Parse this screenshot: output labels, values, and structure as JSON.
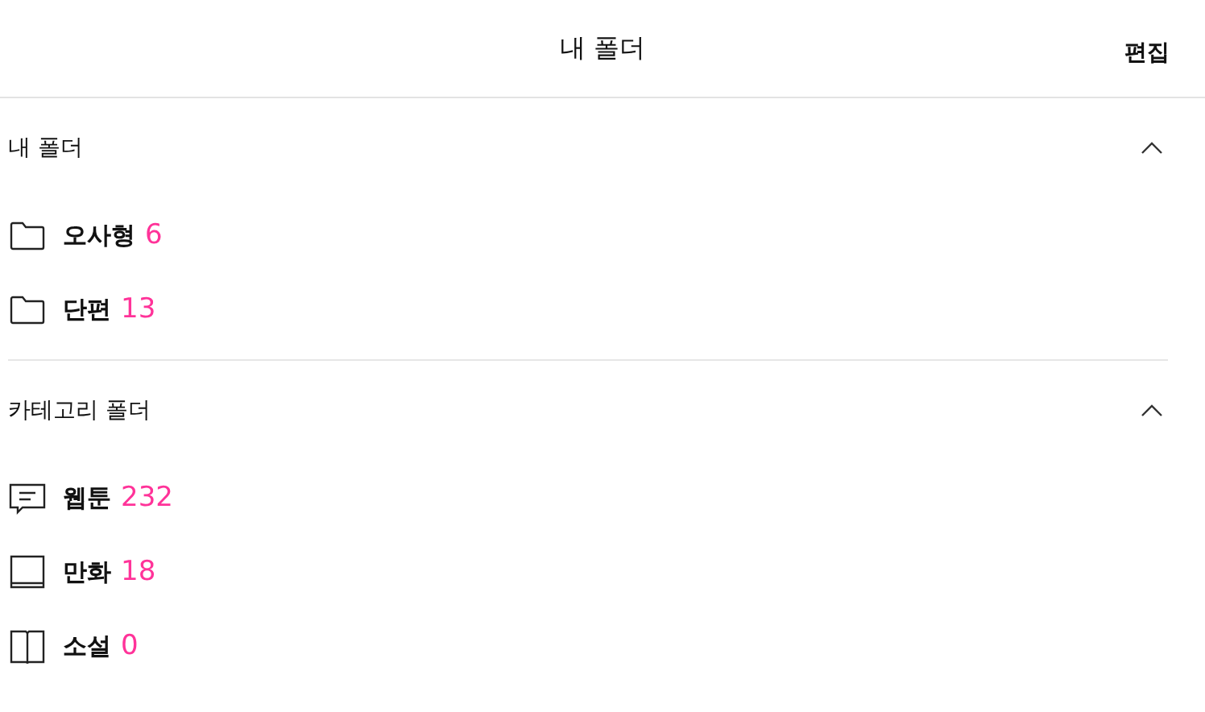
{
  "header": {
    "title": "내 폴더",
    "edit": "편집"
  },
  "sections": [
    {
      "title": "내 폴더",
      "expanded": true,
      "items": [
        {
          "kind": "folder",
          "name": "오사형",
          "count": "6"
        },
        {
          "kind": "folder",
          "name": "단편",
          "count": "13"
        }
      ]
    },
    {
      "title": "카테고리 폴더",
      "expanded": true,
      "items": [
        {
          "kind": "webtoon",
          "name": "웹툰",
          "count": "232"
        },
        {
          "kind": "comic",
          "name": "만화",
          "count": "18"
        },
        {
          "kind": "novel",
          "name": "소설",
          "count": "0"
        }
      ]
    }
  ]
}
